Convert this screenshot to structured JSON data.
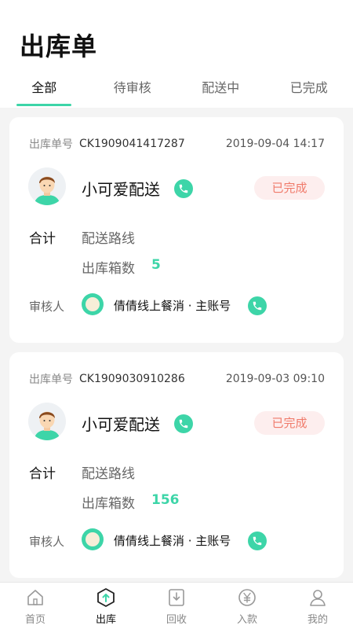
{
  "header": {
    "title": "出库单"
  },
  "tabs": [
    "全部",
    "待审核",
    "配送中",
    "已完成"
  ],
  "active_tab": 0,
  "labels": {
    "order_no": "出库单号",
    "total": "合计",
    "route": "配送路线",
    "boxes": "出库箱数",
    "auditor": "审核人"
  },
  "orders": [
    {
      "order_no": "CK1909041417287",
      "datetime": "2019-09-04 14:17",
      "shop": "小可爱配送",
      "status": "已完成",
      "boxes": "5",
      "auditor": "倩倩线上餐消 · 主账号"
    },
    {
      "order_no": "CK1909030910286",
      "datetime": "2019-09-03 09:10",
      "shop": "小可爱配送",
      "status": "已完成",
      "boxes": "156",
      "auditor": "倩倩线上餐消 · 主账号"
    }
  ],
  "tabbar": [
    {
      "label": "首页",
      "icon": "home-icon"
    },
    {
      "label": "出库",
      "icon": "outbound-icon"
    },
    {
      "label": "回收",
      "icon": "recycle-icon"
    },
    {
      "label": "入款",
      "icon": "yuan-icon"
    },
    {
      "label": "我的",
      "icon": "user-icon"
    }
  ],
  "active_tabbar": 1,
  "colors": {
    "accent": "#3dd5a8",
    "status_text": "#f07a6a",
    "status_bg": "#fdeeee"
  }
}
